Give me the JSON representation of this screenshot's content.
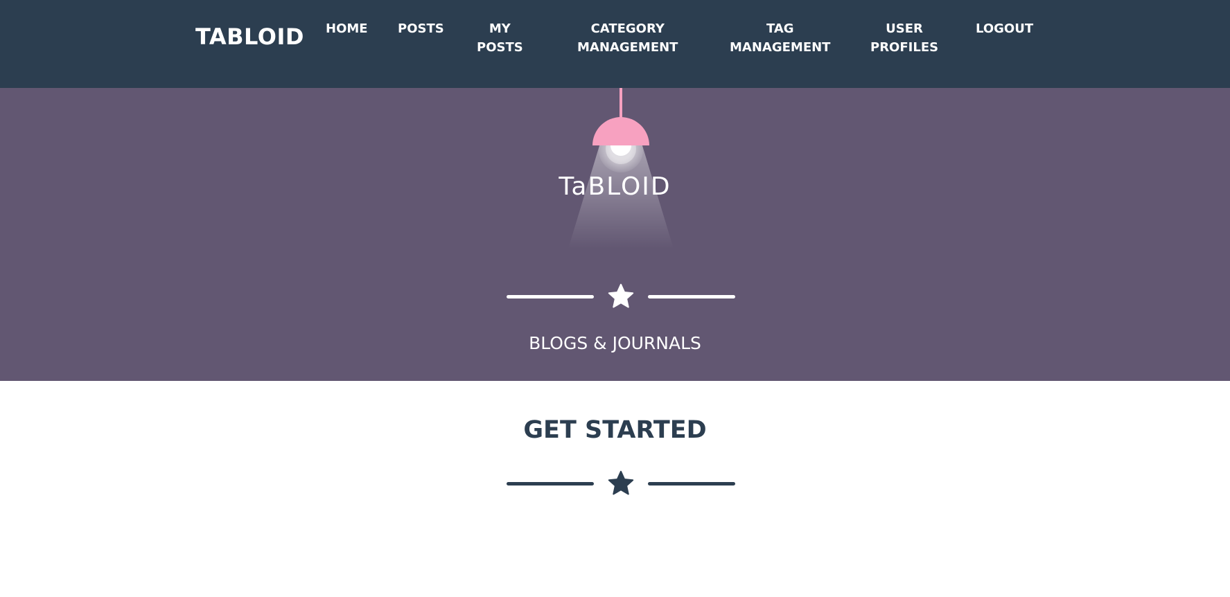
{
  "navbar": {
    "brand": "TABLOID",
    "background": "#2c3e50",
    "items": [
      {
        "line1": "HOME",
        "line2": ""
      },
      {
        "line1": "POSTS",
        "line2": ""
      },
      {
        "line1": "MY",
        "line2": "POSTS"
      },
      {
        "line1": "CATEGORY",
        "line2": "MANAGEMENT"
      },
      {
        "line1": "TAG",
        "line2": "MANAGEMENT"
      },
      {
        "line1": "USER",
        "line2": "PROFILES"
      },
      {
        "line1": "LOGOUT",
        "line2": ""
      }
    ]
  },
  "hero": {
    "background": "#625772",
    "logo_text": "TaBLOID",
    "lamp_color": "#f7a1c0",
    "divider_icon": "star-icon",
    "tagline": "BLOGS & JOURNALS"
  },
  "main": {
    "title": "GET STARTED",
    "title_color": "#2c3e50",
    "divider_icon": "star-icon"
  }
}
